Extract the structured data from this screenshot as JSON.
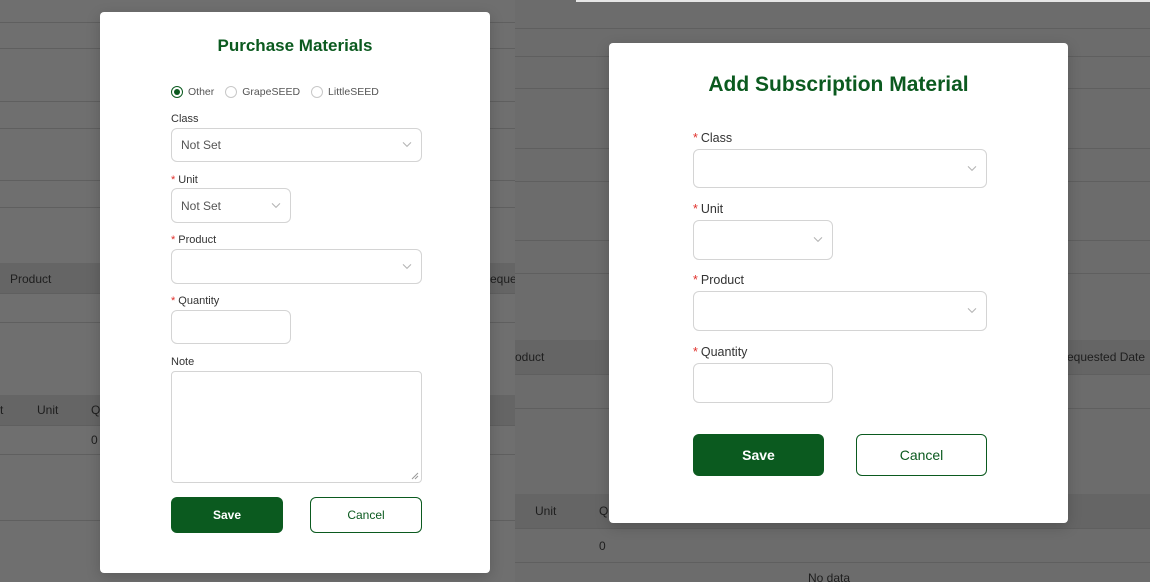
{
  "background_left": {
    "column_product": "Product",
    "column_requested": "eque",
    "column_t": "t",
    "column_unit": "Unit",
    "column_q": "Q",
    "cell_zero": "0"
  },
  "background_right": {
    "column_product": "oduct",
    "column_requested_date": "equested Date",
    "column_unit": "Unit",
    "column_q": "Q",
    "cell_zero": "0",
    "empty_text": "No data"
  },
  "purchase_modal": {
    "title": "Purchase Materials",
    "radios": [
      {
        "label": "Other",
        "checked": true
      },
      {
        "label": "GrapeSEED",
        "checked": false
      },
      {
        "label": "LittleSEED",
        "checked": false
      }
    ],
    "class_label": "Class",
    "class_value": "Not Set",
    "unit_label": "Unit",
    "unit_value": "Not Set",
    "product_label": "Product",
    "product_value": "",
    "quantity_label": "Quantity",
    "quantity_value": "",
    "note_label": "Note",
    "note_value": "",
    "required_mark": "*",
    "save_label": "Save",
    "cancel_label": "Cancel"
  },
  "subscription_modal": {
    "title": "Add Subscription Material",
    "class_label": "Class",
    "class_value": "",
    "unit_label": "Unit",
    "unit_value": "",
    "product_label": "Product",
    "product_value": "",
    "quantity_label": "Quantity",
    "quantity_value": "",
    "required_mark": "*",
    "save_label": "Save",
    "cancel_label": "Cancel"
  },
  "colors": {
    "brand_green": "#0b5a1f",
    "required_red": "#e0302b",
    "overlay_gray": "#6b6b6b"
  }
}
